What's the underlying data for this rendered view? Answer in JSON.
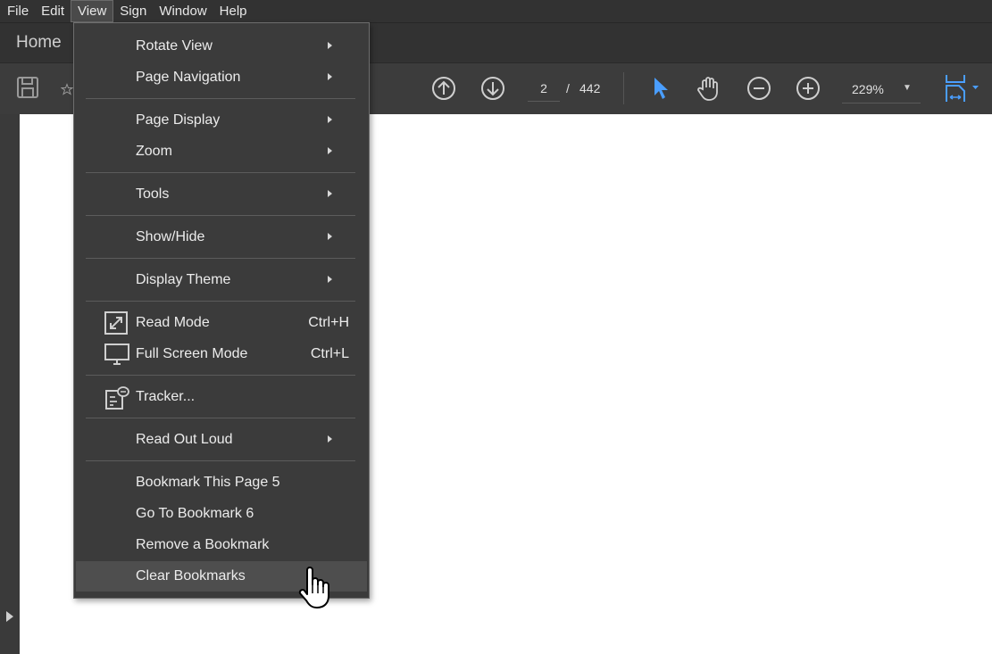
{
  "menubar": {
    "items": [
      "File",
      "Edit",
      "View",
      "Sign",
      "Window",
      "Help"
    ],
    "active": "View"
  },
  "tabs": {
    "home": "Home"
  },
  "toolbar": {
    "current_page": "2",
    "page_separator": "/",
    "total_pages": "442",
    "zoom": "229%",
    "icons": [
      "save-icon",
      "star-icon",
      "arrow-up-circle-icon",
      "arrow-down-circle-icon",
      "select-pointer-icon",
      "hand-icon",
      "zoom-out-icon",
      "zoom-in-icon",
      "page-fit-icon"
    ],
    "accent": "#4a9eff"
  },
  "view_menu": {
    "items": [
      {
        "label": "Rotate View",
        "submenu": true
      },
      {
        "label": "Page Navigation",
        "submenu": true
      },
      {
        "label": "Page Display",
        "submenu": true
      },
      {
        "label": "Zoom",
        "submenu": true
      },
      {
        "label": "Tools",
        "submenu": true
      },
      {
        "label": "Show/Hide",
        "submenu": true
      },
      {
        "label": "Display Theme",
        "submenu": true
      },
      {
        "label": "Read Mode",
        "shortcut": "Ctrl+H",
        "icon": "read-mode-icon"
      },
      {
        "label": "Full Screen Mode",
        "shortcut": "Ctrl+L",
        "icon": "monitor-icon"
      },
      {
        "label": "Tracker...",
        "icon": "tracker-icon"
      },
      {
        "label": "Read Out Loud",
        "submenu": true
      },
      {
        "label": "Bookmark This Page 5"
      },
      {
        "label": "Go To Bookmark 6"
      },
      {
        "label": "Remove a Bookmark"
      },
      {
        "label": "Clear Bookmarks",
        "hovered": true
      }
    ]
  }
}
